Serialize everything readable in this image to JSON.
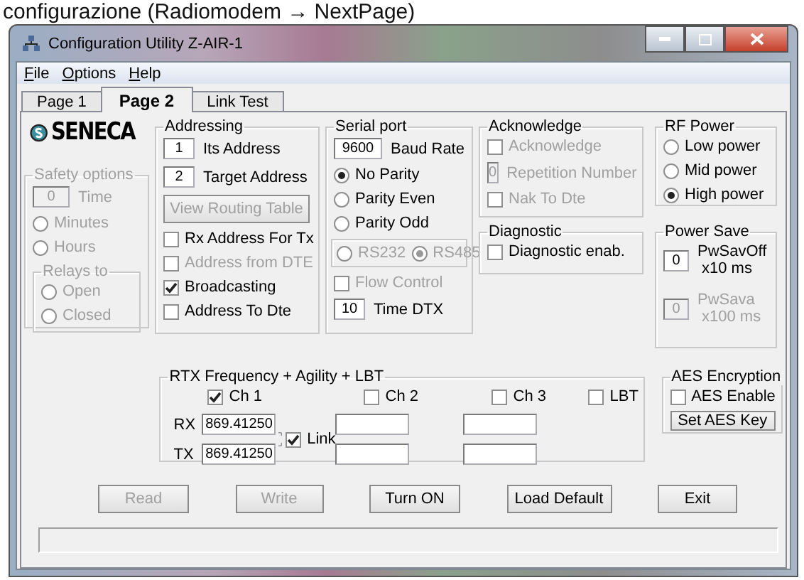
{
  "caption": "configurazione (Radiomodem → NextPage)",
  "window": {
    "title": "Configuration Utility Z-AIR-1"
  },
  "menu": [
    {
      "label": "File"
    },
    {
      "label": "Options"
    },
    {
      "label": "Help"
    }
  ],
  "tabs": [
    {
      "label": "Page 1",
      "selected": false
    },
    {
      "label": "Page 2",
      "selected": true
    },
    {
      "label": "Link Test",
      "selected": false
    }
  ],
  "logo": "SENECA",
  "safety": {
    "title": "Safety options",
    "disabled": true,
    "time": {
      "value": "0",
      "label": "Time"
    },
    "options": [
      {
        "label": "Minutes",
        "selected": false
      },
      {
        "label": "Hours",
        "selected": false
      }
    ],
    "relays": {
      "title": "Relays to",
      "options": [
        {
          "label": "Open",
          "selected": false
        },
        {
          "label": "Closed",
          "selected": false
        }
      ]
    }
  },
  "addressing": {
    "title": "Addressing",
    "fields": [
      {
        "value": "1",
        "label": "Its Address"
      },
      {
        "value": "2",
        "label": "Target Address"
      }
    ],
    "button": {
      "label": "View Routing Table",
      "disabled": true
    },
    "checks": [
      {
        "label": "Rx Address For Tx",
        "checked": false,
        "disabled": false
      },
      {
        "label": "Address from DTE",
        "checked": false,
        "disabled": true
      },
      {
        "label": "Broadcasting",
        "checked": true,
        "disabled": false
      },
      {
        "label": "Address To Dte",
        "checked": false,
        "disabled": false
      }
    ]
  },
  "serial": {
    "title": "Serial port",
    "baud": {
      "value": "9600",
      "label": "Baud Rate"
    },
    "parity": [
      {
        "label": "No Parity",
        "selected": true
      },
      {
        "label": "Parity Even",
        "selected": false
      },
      {
        "label": "Parity Odd",
        "selected": false
      }
    ],
    "interface": {
      "disabled": true,
      "options": [
        {
          "label": "RS232",
          "selected": false
        },
        {
          "label": "RS485",
          "selected": true
        }
      ]
    },
    "flow": {
      "label": "Flow Control",
      "checked": false,
      "disabled": true
    },
    "dtx": {
      "value": "10",
      "label": "Time DTX"
    }
  },
  "acknowledge": {
    "title": "Acknowledge",
    "check": {
      "label": "Acknowledge",
      "checked": false,
      "disabled": true
    },
    "repetition": {
      "value": "0",
      "label": "Repetition Number",
      "disabled": true
    },
    "nak": {
      "label": "Nak To Dte",
      "checked": false,
      "disabled": true
    }
  },
  "diagnostic": {
    "title": "Diagnostic",
    "check": {
      "label": "Diagnostic enab.",
      "checked": false,
      "disabled": false
    }
  },
  "rf_power": {
    "title": "RF Power",
    "options": [
      {
        "label": "Low power",
        "selected": false
      },
      {
        "label": "Mid power",
        "selected": false
      },
      {
        "label": "High power",
        "selected": true
      }
    ]
  },
  "power_save": {
    "title": "Power Save",
    "fields": [
      {
        "value": "0",
        "label": "PwSavOff",
        "unit": "x10 ms",
        "disabled": false
      },
      {
        "value": "0",
        "label": "PwSava",
        "unit": "x100 ms",
        "disabled": true
      }
    ]
  },
  "rtx": {
    "title": "RTX Frequency + Agility + LBT",
    "channels": [
      {
        "label": "Ch 1",
        "checked": true,
        "rx": "869.41250",
        "tx": "869.41250"
      },
      {
        "label": "Ch 2",
        "checked": false
      },
      {
        "label": "Ch 3",
        "checked": false
      }
    ],
    "lbt": {
      "label": "LBT",
      "checked": false
    },
    "rx_label": "RX",
    "tx_label": "TX",
    "link": {
      "label": "Link",
      "checked": true
    }
  },
  "aes": {
    "title": "AES Encryption",
    "enable": {
      "label": "AES Enable",
      "checked": false
    },
    "button": {
      "label": "Set AES Key",
      "disabled": false
    }
  },
  "buttons": [
    {
      "label": "Read",
      "disabled": true
    },
    {
      "label": "Write",
      "disabled": true
    },
    {
      "label": "Turn ON",
      "disabled": false
    },
    {
      "label": "Load Default",
      "disabled": false
    },
    {
      "label": "Exit",
      "disabled": false
    }
  ]
}
